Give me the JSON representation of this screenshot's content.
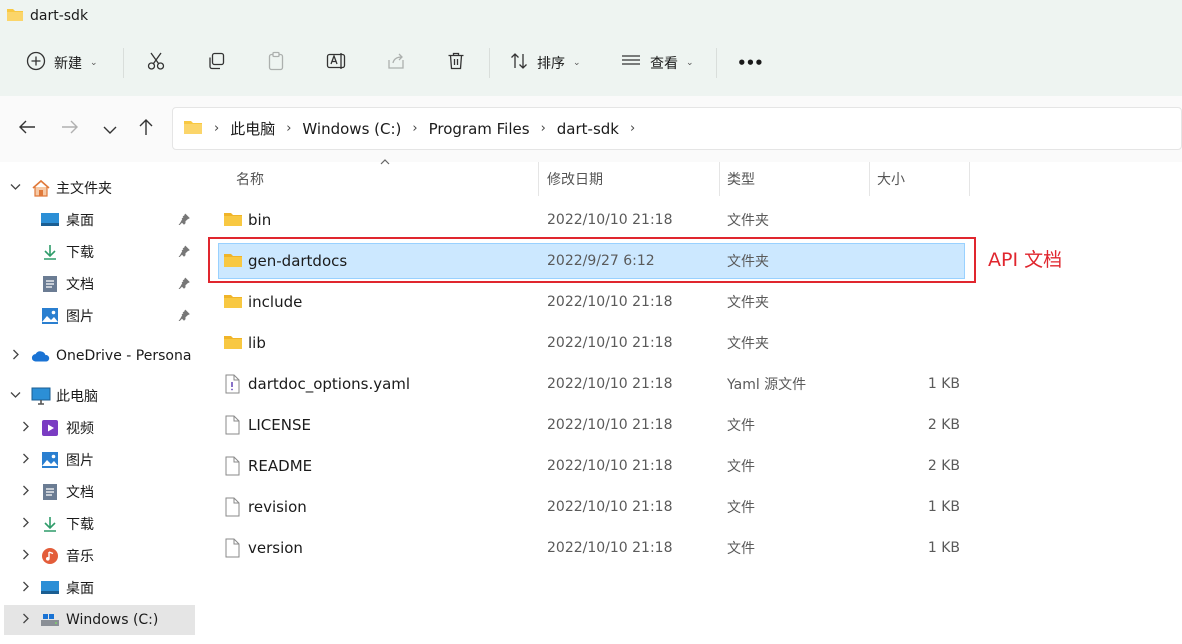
{
  "window": {
    "title": "dart-sdk"
  },
  "toolbar": {
    "new_label": "新建",
    "sort_label": "排序",
    "view_label": "查看",
    "more_label": "•••"
  },
  "breadcrumb": [
    "此电脑",
    "Windows (C:)",
    "Program Files",
    "dart-sdk"
  ],
  "columns": {
    "name": "名称",
    "date": "修改日期",
    "type": "类型",
    "size": "大小"
  },
  "sidebar": {
    "items": [
      {
        "label": "主文件夹",
        "icon": "home-icon"
      },
      {
        "label": "桌面",
        "icon": "desktop-icon",
        "pinned": true
      },
      {
        "label": "下载",
        "icon": "download-icon",
        "pinned": true
      },
      {
        "label": "文档",
        "icon": "document-icon",
        "pinned": true
      },
      {
        "label": "图片",
        "icon": "picture-icon",
        "pinned": true
      },
      {
        "label": "OneDrive - Persona",
        "icon": "onedrive-icon"
      },
      {
        "label": "此电脑",
        "icon": "this-pc-icon"
      },
      {
        "label": "视频",
        "icon": "video-icon"
      },
      {
        "label": "图片",
        "icon": "picture-icon"
      },
      {
        "label": "文档",
        "icon": "document-icon"
      },
      {
        "label": "下载",
        "icon": "download-icon"
      },
      {
        "label": "音乐",
        "icon": "music-icon"
      },
      {
        "label": "桌面",
        "icon": "desktop-icon"
      },
      {
        "label": "Windows (C:)",
        "icon": "drive-icon",
        "selected": true
      }
    ]
  },
  "files": [
    {
      "name": "bin",
      "date": "2022/10/10 21:18",
      "type": "文件夹",
      "size": "",
      "icon": "folder-icon"
    },
    {
      "name": "gen-dartdocs",
      "date": "2022/9/27 6:12",
      "type": "文件夹",
      "size": "",
      "icon": "folder-icon",
      "selected": true
    },
    {
      "name": "include",
      "date": "2022/10/10 21:18",
      "type": "文件夹",
      "size": "",
      "icon": "folder-icon"
    },
    {
      "name": "lib",
      "date": "2022/10/10 21:18",
      "type": "文件夹",
      "size": "",
      "icon": "folder-icon"
    },
    {
      "name": "dartdoc_options.yaml",
      "date": "2022/10/10 21:18",
      "type": "Yaml 源文件",
      "size": "1 KB",
      "icon": "yaml-file-icon"
    },
    {
      "name": "LICENSE",
      "date": "2022/10/10 21:18",
      "type": "文件",
      "size": "2 KB",
      "icon": "file-icon"
    },
    {
      "name": "README",
      "date": "2022/10/10 21:18",
      "type": "文件",
      "size": "2 KB",
      "icon": "file-icon"
    },
    {
      "name": "revision",
      "date": "2022/10/10 21:18",
      "type": "文件",
      "size": "1 KB",
      "icon": "file-icon"
    },
    {
      "name": "version",
      "date": "2022/10/10 21:18",
      "type": "文件",
      "size": "1 KB",
      "icon": "file-icon"
    }
  ],
  "annotation": {
    "label": "API 文档",
    "color": "#e0262e"
  },
  "colors": {
    "selection": "#cce8ff",
    "folder": "#f8c842",
    "accent": "#0067c0"
  }
}
